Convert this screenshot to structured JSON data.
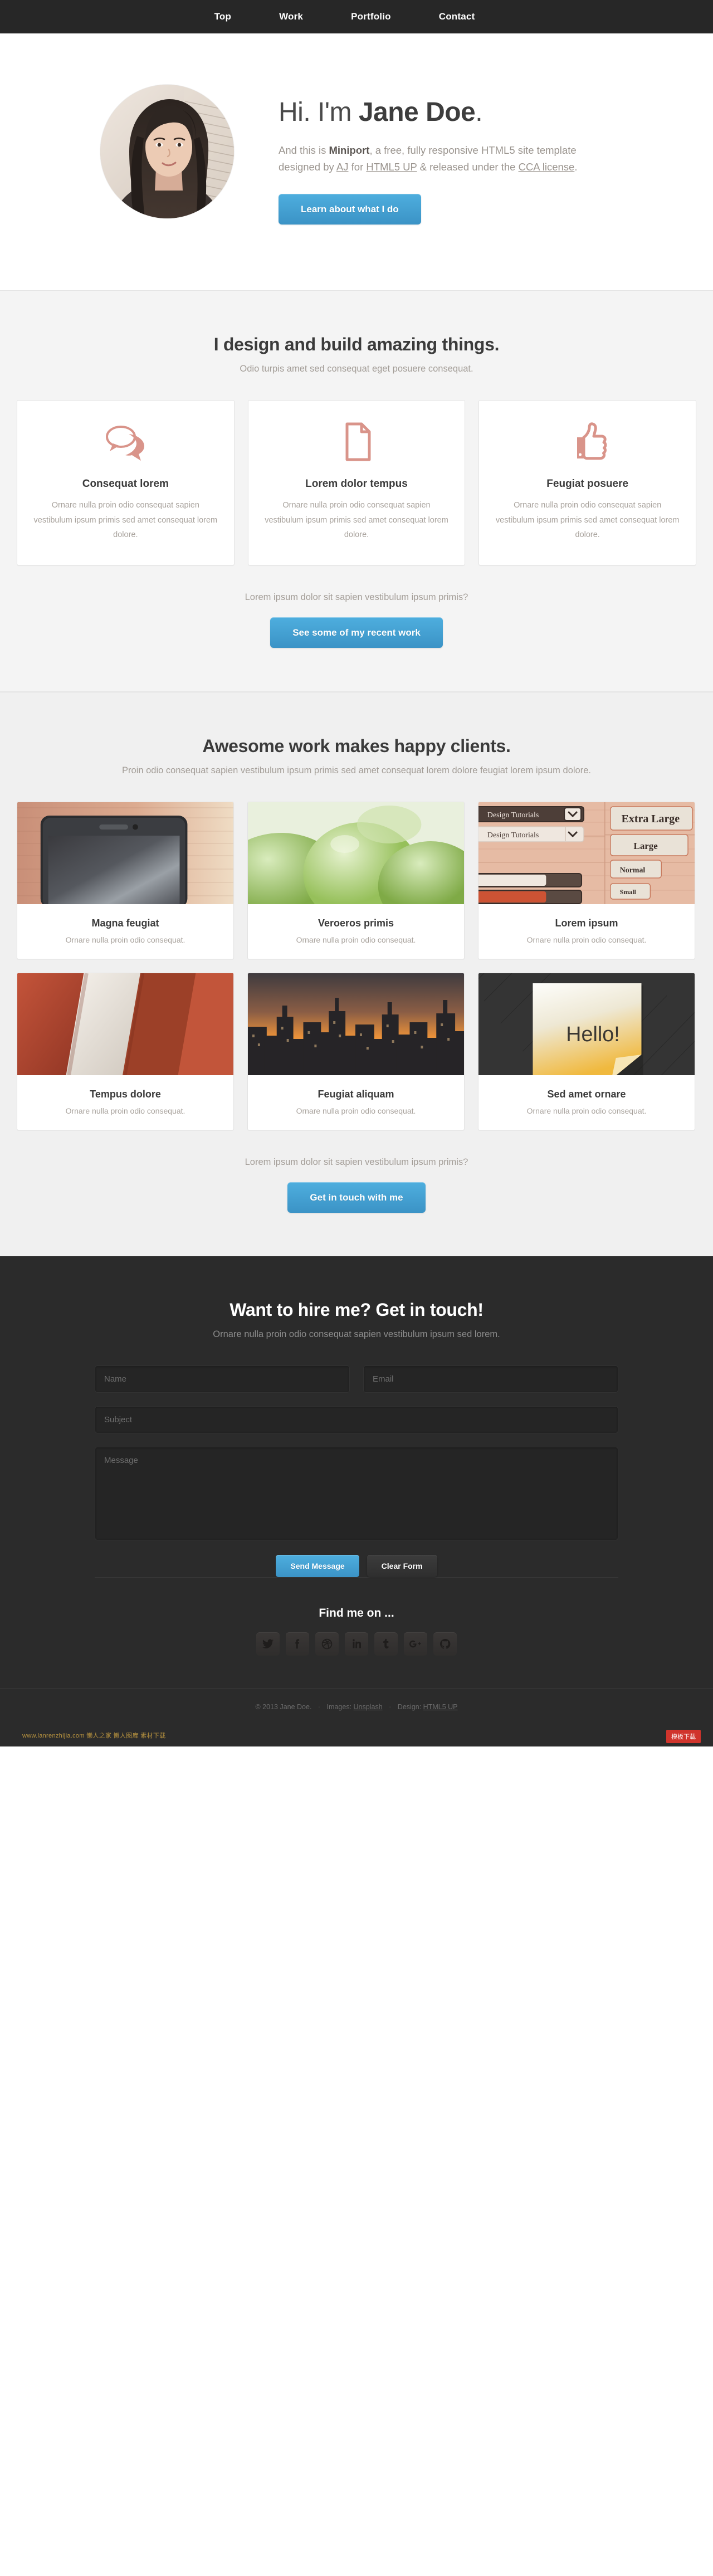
{
  "nav": {
    "items": [
      {
        "label": "Top",
        "name": "nav-top"
      },
      {
        "label": "Work",
        "name": "nav-work"
      },
      {
        "label": "Portfolio",
        "name": "nav-portfolio"
      },
      {
        "label": "Contact",
        "name": "nav-contact"
      }
    ]
  },
  "hero": {
    "greeting_prefix": "Hi. I'm ",
    "name": "Jane Doe",
    "greeting_suffix": ".",
    "intro_1": "And this is ",
    "intro_brand": "Miniport",
    "intro_2": ", a free, fully responsive HTML5 site template designed by ",
    "link_aj": "AJ",
    "intro_3": " for ",
    "link_html5up": "HTML5 UP",
    "intro_4": " & released under the ",
    "link_cca": "CCA license",
    "intro_5": ".",
    "cta_label": "Learn about what I do"
  },
  "work": {
    "title": "I design and build amazing things.",
    "subtitle": "Odio turpis amet sed consequat eget posuere consequat.",
    "features": [
      {
        "icon": "speech-bubbles-icon",
        "title": "Consequat lorem",
        "body": "Ornare nulla proin odio consequat sapien vestibulum ipsum primis sed amet consequat lorem dolore."
      },
      {
        "icon": "document-icon",
        "title": "Lorem dolor tempus",
        "body": "Ornare nulla proin odio consequat sapien vestibulum ipsum primis sed amet consequat lorem dolore."
      },
      {
        "icon": "thumbs-up-icon",
        "title": "Feugiat posuere",
        "body": "Ornare nulla proin odio consequat sapien vestibulum ipsum primis sed amet consequat lorem dolore."
      }
    ],
    "cta_line": "Lorem ipsum dolor sit sapien vestibulum ipsum primis?",
    "cta_label": "See some of my recent work"
  },
  "portfolio": {
    "title": "Awesome work makes happy clients.",
    "subtitle": "Proin odio consequat sapien vestibulum ipsum primis sed amet consequat lorem dolore feugiat lorem ipsum dolore.",
    "items": [
      {
        "thumb": "phone-on-wood-thumb",
        "title": "Magna feugiat",
        "caption": "Ornare nulla proin odio consequat."
      },
      {
        "thumb": "green-balloons-thumb",
        "title": "Veroeros primis",
        "caption": "Ornare nulla proin odio consequat."
      },
      {
        "thumb": "ui-kit-thumb",
        "title": "Lorem ipsum",
        "caption": "Ornare nulla proin odio consequat."
      },
      {
        "thumb": "red-paper-thumb",
        "title": "Tempus dolore",
        "caption": "Ornare nulla proin odio consequat."
      },
      {
        "thumb": "city-skyline-thumb",
        "title": "Feugiat aliquam",
        "caption": "Ornare nulla proin odio consequat."
      },
      {
        "thumb": "sticky-note-thumb",
        "title": "Sed amet ornare",
        "caption": "Ornare nulla proin odio consequat."
      }
    ],
    "ui_kit": {
      "select_1": "Design Tutorials",
      "select_2": "Design Tutorials",
      "btn_xl": "Extra Large",
      "btn_large": "Large",
      "btn_normal": "Normal",
      "btn_small": "Small"
    },
    "sticky_note_text": "Hello!",
    "cta_line": "Lorem ipsum dolor sit sapien vestibulum ipsum primis?",
    "cta_label": "Get in touch with me"
  },
  "contact": {
    "title": "Want to hire me? Get in touch!",
    "subtitle": "Ornare nulla proin odio consequat sapien vestibulum ipsum sed lorem.",
    "fields": {
      "name_placeholder": "Name",
      "name_value": "",
      "email_placeholder": "Email",
      "email_value": "",
      "subject_placeholder": "Subject",
      "subject_value": "",
      "message_placeholder": "Message",
      "message_value": ""
    },
    "send_label": "Send Message",
    "clear_label": "Clear Form"
  },
  "social": {
    "heading": "Find me on ...",
    "items": [
      {
        "name": "twitter-icon",
        "label": "Twitter"
      },
      {
        "name": "facebook-icon",
        "label": "Facebook"
      },
      {
        "name": "dribbble-icon",
        "label": "Dribbble"
      },
      {
        "name": "linkedin-icon",
        "label": "LinkedIn"
      },
      {
        "name": "tumblr-icon",
        "label": "Tumblr"
      },
      {
        "name": "google-plus-icon",
        "label": "Google+"
      },
      {
        "name": "github-icon",
        "label": "GitHub"
      }
    ]
  },
  "footer": {
    "copyright": "© 2013 Jane Doe.",
    "images_label": "Images:",
    "images_link": "Unsplash",
    "design_label": "Design:",
    "design_link": "HTML5 UP"
  },
  "overlay": {
    "watermark": "www.lanrenzhijia.com 懒人之家 懒人图库 素材下载",
    "badge": "模板下载"
  },
  "colors": {
    "accent_blue": "#42a0d2",
    "icon_salmon": "#d9948a",
    "dark_bg": "#2b2b2b",
    "nav_bg": "#272727"
  }
}
